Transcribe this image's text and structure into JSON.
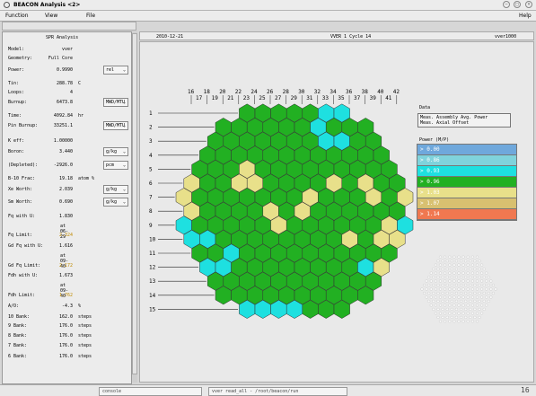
{
  "window": {
    "title": "BEACON Analysis <2>"
  },
  "menu": {
    "function": "Function",
    "view": "View",
    "file": "File",
    "help": "Help"
  },
  "left_panel": {
    "header": "SPR Analysis",
    "rows": [
      {
        "label": "Model:",
        "value": "vver",
        "unit": "",
        "btn": ""
      },
      {
        "label": "Geometry:",
        "value": "Full Core",
        "unit": "",
        "btn": ""
      },
      {
        "label": "Power:",
        "value": "0.9990",
        "unit": "",
        "btn": "rel"
      },
      {
        "label": "Tin:",
        "value": "288.78",
        "unit": "C",
        "btn": ""
      },
      {
        "label": "Loops:",
        "value": "4",
        "unit": "",
        "btn": ""
      },
      {
        "label": "Burnup:",
        "value": "6473.8",
        "unit": "",
        "btn": "MWD/MTU"
      },
      {
        "label": "Time:",
        "value": "4092.84",
        "unit": "hr",
        "btn": ""
      },
      {
        "label": "Pin Burnup:",
        "value": "33251.1",
        "unit": "",
        "btn": "MWD/MTU"
      },
      {
        "label": "K eff:",
        "value": "1.00000",
        "unit": "",
        "btn": ""
      },
      {
        "label": "Boron:",
        "value": "3.440",
        "unit": "",
        "btn": "g/kg"
      },
      {
        "label": "(Depleted):",
        "value": "-2926.0",
        "unit": "",
        "btn": "pcm"
      },
      {
        "label": "B-10 Frac:",
        "value": "19.18",
        "unit": "atom %",
        "btn": ""
      },
      {
        "label": "Xe Worth:",
        "value": "2.039",
        "unit": "",
        "btn": "g/kg"
      },
      {
        "label": "Sm Worth:",
        "value": "0.690",
        "unit": "",
        "btn": "g/kg"
      },
      {
        "label": "Fq with U:",
        "value": "1.830",
        "unit": "",
        "btn": ""
      },
      {
        "label": "at 06-29",
        "value": "",
        "unit": "",
        "btn": "",
        "sub": true
      },
      {
        "label": "Fq Limit:",
        "value": "2.324",
        "unit": "",
        "btn": "",
        "amber": true
      },
      {
        "label": "Gd Fq with U:",
        "value": "1.616",
        "unit": "",
        "btn": ""
      },
      {
        "label": "at 09-40",
        "value": "",
        "unit": "",
        "btn": "",
        "sub": true
      },
      {
        "label": "Gd Fq Limit:",
        "value": "2.172",
        "unit": "",
        "btn": "",
        "amber": true
      },
      {
        "label": "Fdh with U:",
        "value": "1.673",
        "unit": "",
        "btn": ""
      },
      {
        "label": "at 09-40",
        "value": "",
        "unit": "",
        "btn": "",
        "sub": true
      },
      {
        "label": "Fdh Limit:",
        "value": "1.762",
        "unit": "",
        "btn": "",
        "amber": true
      },
      {
        "label": "A/O:",
        "value": "-4.3",
        "unit": "%",
        "btn": ""
      },
      {
        "label": "10 Bank:",
        "value": "162.0",
        "unit": "steps",
        "btn": ""
      },
      {
        "label": "9 Bank:",
        "value": "176.0",
        "unit": "steps",
        "btn": ""
      },
      {
        "label": "8 Bank:",
        "value": "176.0",
        "unit": "steps",
        "btn": ""
      },
      {
        "label": "7 Bank:",
        "value": "176.0",
        "unit": "steps",
        "btn": ""
      },
      {
        "label": "6 Bank:",
        "value": "176.0",
        "unit": "steps",
        "btn": ""
      }
    ]
  },
  "status": {
    "date": "2010-12-21",
    "cycle": "VVER 1  Cycle 14",
    "plant": "vver1000"
  },
  "col_labels_top": [
    "16",
    "18",
    "20",
    "22",
    "24",
    "26",
    "28",
    "30",
    "32",
    "34",
    "36",
    "38",
    "40",
    "42"
  ],
  "col_labels_bottom": [
    "17",
    "19",
    "21",
    "23",
    "25",
    "27",
    "29",
    "31",
    "33",
    "35",
    "37",
    "39",
    "41"
  ],
  "row_labels": [
    "1",
    "2",
    "3",
    "4",
    "5",
    "6",
    "7",
    "8",
    "9",
    "10",
    "11",
    "12",
    "13",
    "14",
    "15"
  ],
  "data_legend": {
    "title": "Data",
    "line1": "Meas. Assembly Avg. Power",
    "line2": "Meas. Axial Offset"
  },
  "power_legend": {
    "title": "Power (M/P)",
    "items": [
      {
        "label": "> 0.00",
        "color": "#6fa8dc"
      },
      {
        "label": "> 0.86",
        "color": "#7fd3dc"
      },
      {
        "label": "> 0.93",
        "color": "#1ee0e0"
      },
      {
        "label": "> 0.96",
        "color": "#22b022"
      },
      {
        "label": "> 1.03",
        "color": "#e8e08a"
      },
      {
        "label": "> 1.07",
        "color": "#d8c070"
      },
      {
        "label": "> 1.14",
        "color": "#f07850"
      }
    ]
  },
  "colors": {
    "green": "#22b022",
    "cyan": "#1ee0e0",
    "yellow": "#e8e08a",
    "blue": "#6fa8dc"
  },
  "core_rows": [
    {
      "cells": [
        "g",
        "g",
        "g",
        "g",
        "g",
        "c",
        "c"
      ]
    },
    {
      "cells": [
        "g",
        "g",
        "g",
        "g",
        "g",
        "g",
        "c",
        "g",
        "g",
        "g"
      ]
    },
    {
      "cells": [
        "g",
        "g",
        "g",
        "g",
        "g",
        "g",
        "g",
        "c",
        "c",
        "g",
        "g"
      ]
    },
    {
      "cells": [
        "g",
        "g",
        "g",
        "g",
        "g",
        "g",
        "g",
        "g",
        "g",
        "g",
        "g",
        "g"
      ]
    },
    {
      "cells": [
        "g",
        "g",
        "g",
        "y",
        "g",
        "g",
        "g",
        "g",
        "g",
        "g",
        "g",
        "g",
        "g"
      ]
    },
    {
      "cells": [
        "y",
        "g",
        "g",
        "y",
        "y",
        "g",
        "g",
        "g",
        "g",
        "y",
        "g",
        "y",
        "g",
        "g"
      ]
    },
    {
      "cells": [
        "y",
        "g",
        "g",
        "g",
        "g",
        "g",
        "g",
        "g",
        "y",
        "g",
        "g",
        "g",
        "y",
        "g",
        "y"
      ]
    },
    {
      "cells": [
        "y",
        "g",
        "g",
        "g",
        "g",
        "y",
        "g",
        "y",
        "g",
        "g",
        "g",
        "g",
        "g",
        "g"
      ]
    },
    {
      "cells": [
        "c",
        "g",
        "g",
        "g",
        "g",
        "g",
        "y",
        "g",
        "g",
        "g",
        "g",
        "g",
        "g",
        "y",
        "c"
      ]
    },
    {
      "cells": [
        "c",
        "c",
        "g",
        "g",
        "g",
        "g",
        "g",
        "g",
        "g",
        "g",
        "y",
        "g",
        "y",
        "y"
      ]
    },
    {
      "cells": [
        "g",
        "g",
        "c",
        "g",
        "g",
        "g",
        "g",
        "g",
        "g",
        "g",
        "g",
        "g",
        "g"
      ]
    },
    {
      "cells": [
        "c",
        "c",
        "g",
        "g",
        "g",
        "g",
        "g",
        "g",
        "g",
        "g",
        "c",
        "y"
      ]
    },
    {
      "cells": [
        "g",
        "g",
        "g",
        "g",
        "g",
        "g",
        "g",
        "g",
        "g",
        "g",
        "g"
      ]
    },
    {
      "cells": [
        "g",
        "g",
        "g",
        "g",
        "g",
        "g",
        "g",
        "g",
        "g",
        "g"
      ]
    },
    {
      "cells": [
        "c",
        "c",
        "c",
        "c",
        "g",
        "g",
        "g"
      ]
    }
  ],
  "taskbar": {
    "item1": "console",
    "item2": "vver read_all - /root/beacon/run",
    "clock": "16"
  }
}
